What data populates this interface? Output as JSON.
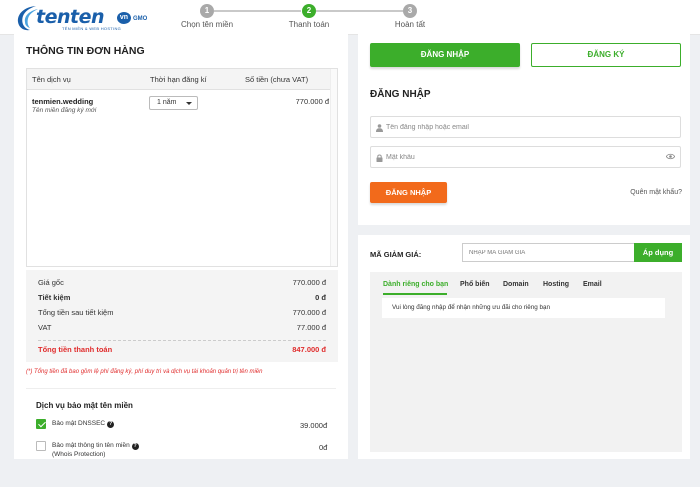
{
  "brand": {
    "name": "tenten",
    "badge": "vn",
    "partner": "GMO",
    "tagline": "TÊN MIỀN & WEB HOSTING",
    "color": "#1a5faa"
  },
  "steps": [
    {
      "number": "1",
      "label": "Chọn tên miền"
    },
    {
      "number": "2",
      "label": "Thanh toán"
    },
    {
      "number": "3",
      "label": "Hoàn tất"
    }
  ],
  "order": {
    "title": "THÔNG TIN ĐƠN HÀNG",
    "columns": [
      "Tên dịch vụ",
      "Thời hạn đăng kí",
      "Số tiền (chưa VAT)"
    ],
    "items": [
      {
        "name": "tenmien.wedding",
        "note": "Tên miền đăng ký mới",
        "period": "1 năm",
        "price": "770.000 đ"
      }
    ],
    "summary": [
      {
        "label": "Giá gốc",
        "value": "770.000 đ"
      },
      {
        "label": "Tiết kiệm",
        "value": "0 đ"
      },
      {
        "label": "Tổng tiền sau tiết kiệm",
        "value": "770.000 đ"
      },
      {
        "label": "VAT",
        "value": "77.000 đ"
      },
      {
        "label": "Tổng tiền thanh toán",
        "value": "847.000 đ"
      }
    ],
    "note": "(*) Tổng tiền đã bao gồm lệ phí đăng ký, phí duy trì và dịch vụ tài khoản quản trị tên miền"
  },
  "security": {
    "title": "Dịch vụ bảo mật tên miền",
    "items": [
      {
        "label": "Bảo mật DNSSEC",
        "help": "?",
        "price": "39.000đ"
      },
      {
        "label": "Bảo mật thông tin tên miền",
        "sub": "(Whois Protection)",
        "help": "?",
        "price": "0đ"
      }
    ]
  },
  "auth": {
    "tab_login": "ĐĂNG NHẬP",
    "tab_register": "ĐĂNG KÝ",
    "title": "ĐĂNG NHẬP",
    "username_placeholder": "Tên đăng nhập hoặc email",
    "password_placeholder": "Mật khẩu",
    "submit": "ĐĂNG NHẬP",
    "forgot": "Quên mật khẩu?"
  },
  "promo": {
    "label": "MÃ GIẢM GIÁ:",
    "placeholder": "NHẬP MÃ GIẢM GIÁ",
    "apply": "Áp dụng",
    "tabs": [
      "Dành riêng cho bạn",
      "Phổ biến",
      "Domain",
      "Hosting",
      "Email"
    ],
    "message": "Vui lòng đăng nhập để nhận những ưu đãi cho riêng bạn"
  },
  "colors": {
    "accent_green": "#3cae2b",
    "orange": "#f26a1b",
    "total_red": "#e02d2d",
    "step_inactive": "#a9a9a9"
  }
}
